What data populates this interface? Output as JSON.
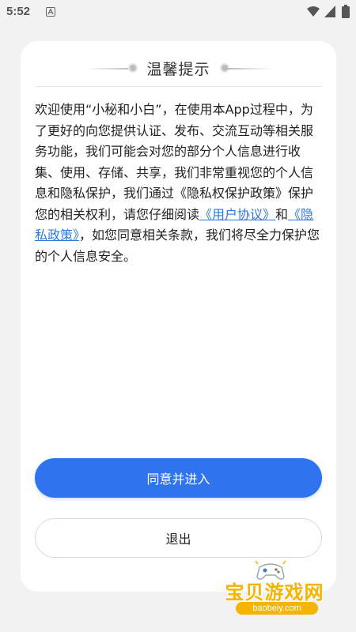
{
  "status_bar": {
    "time": "5:52",
    "icons": [
      "notification-a-icon",
      "wifi-icon",
      "signal-icon",
      "battery-icon"
    ]
  },
  "dialog": {
    "title": "温馨提示",
    "body": {
      "part1": "欢迎使用“小秘和小白”，在使用本App过程中，为了更好的向您提供认证、发布、交流互动等相关服务功能，我们可能会对您的部分个人信息进行收集、使用、存储、共享，我们非常重视您的个人信息和隐私保护，我们通过《隐私权保护政策》保护您的相关权利，请您仔细阅读",
      "link_user_agreement": "《用户协议》",
      "connector": "和",
      "link_privacy_policy": "《隐私政策》",
      "part2": "，如您同意相关条款，我们将尽全力保护您的个人信息安全。"
    },
    "agree_button": "同意并进入",
    "exit_button": "退出"
  },
  "watermark": {
    "text": "宝贝游戏网",
    "url": "baobeiy.com"
  },
  "colors": {
    "primary": "#2f73ee",
    "link": "#2a7ae2",
    "watermark": "#f4b400"
  }
}
